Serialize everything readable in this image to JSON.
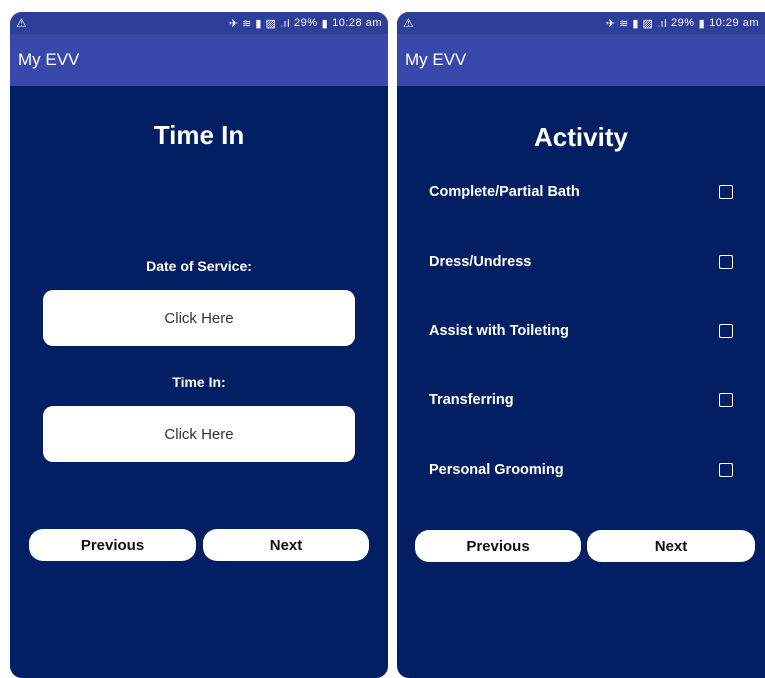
{
  "screens": [
    {
      "status": {
        "time": "10:28 am",
        "battery": "29%"
      },
      "app_title": "My EVV",
      "heading": "Time In",
      "date_label": "Date of Service:",
      "date_button": "Click Here",
      "time_label": "Time In:",
      "time_button": "Click Here",
      "previous": "Previous",
      "next": "Next"
    },
    {
      "status": {
        "time": "10:29 am",
        "battery": "29%"
      },
      "app_title": "My EVV",
      "heading": "Activity",
      "activities": [
        "Complete/Partial Bath",
        "Dress/Undress",
        "Assist with Toileting",
        "Transferring",
        "Personal Grooming"
      ],
      "previous": "Previous",
      "next": "Next"
    }
  ],
  "colors": {
    "background": "#031f63",
    "appbar": "#3949ab",
    "statusbar": "#2e3f9a"
  }
}
